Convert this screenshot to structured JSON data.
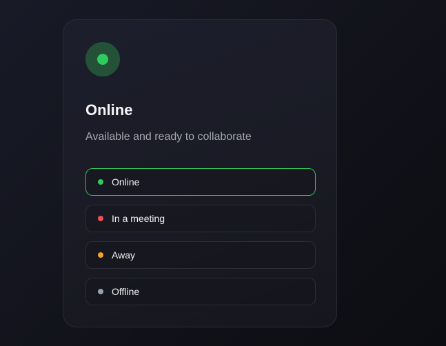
{
  "status": {
    "selected": "online",
    "title": "Online",
    "description": "Available and ready to collaborate",
    "hero_color": "#2ecc5f"
  },
  "options": [
    {
      "id": "online",
      "label": "Online",
      "color": "#2ecc5f"
    },
    {
      "id": "meeting",
      "label": "In a meeting",
      "color": "#ef5050"
    },
    {
      "id": "away",
      "label": "Away",
      "color": "#f5a12e"
    },
    {
      "id": "offline",
      "label": "Offline",
      "color": "#98a2b3"
    }
  ]
}
